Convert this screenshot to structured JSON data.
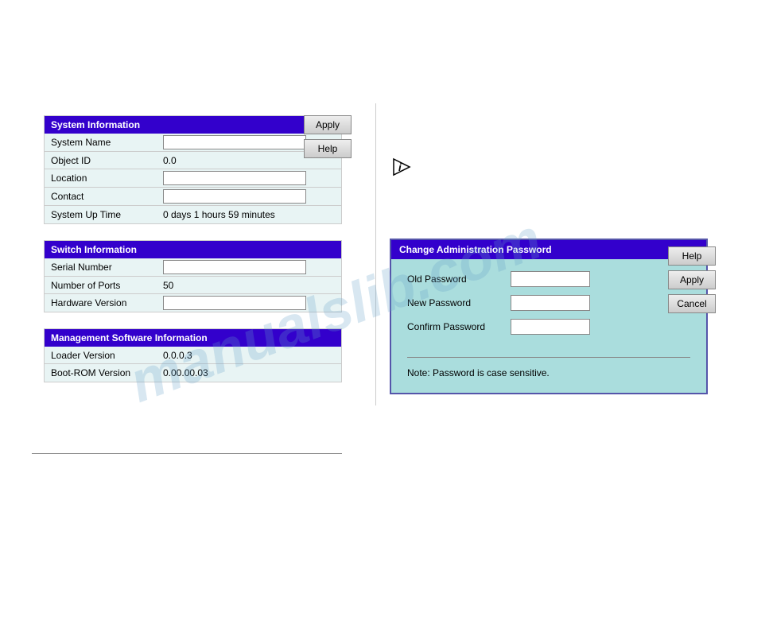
{
  "watermark": {
    "text": "manualslib.com"
  },
  "left_panel": {
    "system_info": {
      "header": "System Information",
      "rows": [
        {
          "label": "System Name",
          "type": "input",
          "value": ""
        },
        {
          "label": "Object ID",
          "type": "text",
          "value": "0.0"
        },
        {
          "label": "Location",
          "type": "input",
          "value": ""
        },
        {
          "label": "Contact",
          "type": "input",
          "value": ""
        },
        {
          "label": "System Up Time",
          "type": "text",
          "value": "0 days 1 hours 59 minutes"
        }
      ]
    },
    "switch_info": {
      "header": "Switch Information",
      "rows": [
        {
          "label": "Serial Number",
          "type": "input",
          "value": ""
        },
        {
          "label": "Number of Ports",
          "type": "text",
          "value": "50"
        },
        {
          "label": "Hardware Version",
          "type": "input",
          "value": ""
        }
      ]
    },
    "management_info": {
      "header": "Management Software Information",
      "rows": [
        {
          "label": "Loader Version",
          "type": "text",
          "value": "0.0.0.3"
        },
        {
          "label": "Boot-ROM Version",
          "type": "text",
          "value": "0.00.00.03"
        }
      ]
    }
  },
  "action_buttons": {
    "apply": "Apply",
    "help": "Help"
  },
  "info_icon": "i",
  "password_dialog": {
    "header": "Change Administration Password",
    "fields": [
      {
        "label": "Old Password",
        "value": ""
      },
      {
        "label": "New Password",
        "value": ""
      },
      {
        "label": "Confirm Password",
        "value": ""
      }
    ],
    "note": "Note: Password is case sensitive.",
    "buttons": {
      "help": "Help",
      "apply": "Apply",
      "cancel": "Cancel"
    }
  }
}
